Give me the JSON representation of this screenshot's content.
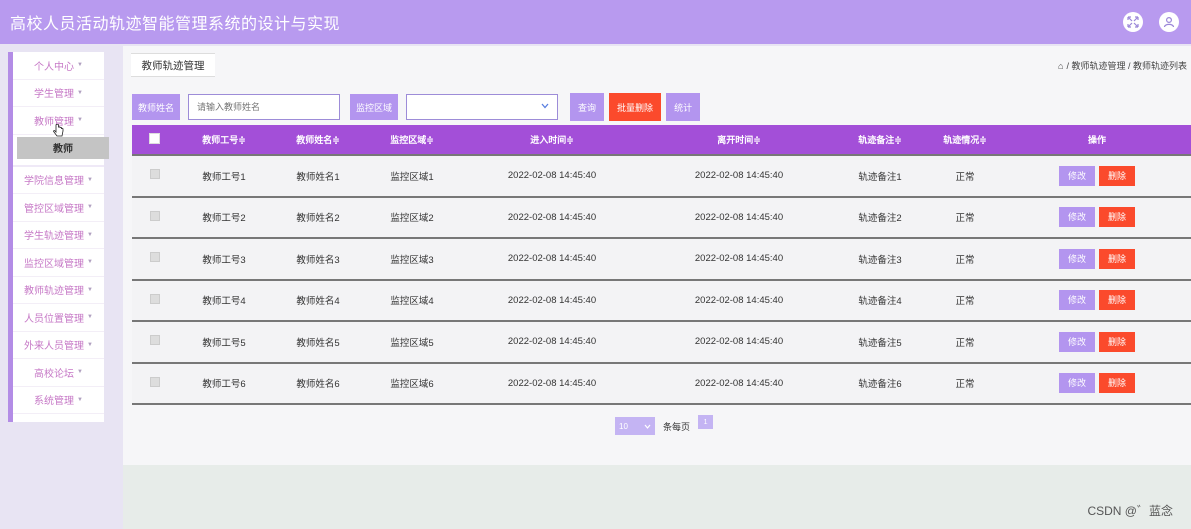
{
  "header": {
    "title": "高校人员活动轨迹智能管理系统的设计与实现",
    "icons": [
      "fullscreen-icon",
      "user-icon"
    ]
  },
  "sidebar": {
    "items_top": [
      {
        "label": "个人中心",
        "caret": "▼"
      },
      {
        "label": "学生管理",
        "caret": "▼"
      },
      {
        "label": "教师管理",
        "caret": "▼"
      }
    ],
    "sub_item": "教师",
    "items_bottom": [
      {
        "label": "学院信息管理",
        "caret": "▼"
      },
      {
        "label": "管控区域管理",
        "caret": "▼"
      },
      {
        "label": "学生轨迹管理",
        "caret": "▼"
      },
      {
        "label": "监控区域管理",
        "caret": "▼"
      },
      {
        "label": "教师轨迹管理",
        "caret": "▼"
      },
      {
        "label": "人员位置管理",
        "caret": "▼"
      },
      {
        "label": "外来人员管理",
        "caret": "▼"
      },
      {
        "label": "高校论坛",
        "caret": "▼"
      },
      {
        "label": "系统管理",
        "caret": "▼"
      }
    ]
  },
  "tab": {
    "label": "教师轨迹管理"
  },
  "breadcrumb": {
    "home_icon": "⌂",
    "text": "/ 教师轨迹管理 / 教师轨迹列表"
  },
  "search": {
    "name_label": "教师姓名",
    "name_placeholder": "请输入教师姓名",
    "area_label": "监控区域",
    "area_value": "",
    "query_btn": "查询",
    "batch_delete_btn": "批量删除",
    "stats_btn": "统计"
  },
  "table": {
    "headers": [
      "教师工号",
      "教师姓名",
      "监控区域",
      "进入时间",
      "离开时间",
      "轨迹备注",
      "轨迹情况",
      "操作"
    ],
    "sort_glyph": "≑",
    "edit_label": "修改",
    "delete_label": "删除",
    "rows": [
      {
        "id": "教师工号1",
        "name": "教师姓名1",
        "area": "监控区域1",
        "enter": "2022-02-08 14:45:40",
        "leave": "2022-02-08 14:45:40",
        "note": "轨迹备注1",
        "status": "正常"
      },
      {
        "id": "教师工号2",
        "name": "教师姓名2",
        "area": "监控区域2",
        "enter": "2022-02-08 14:45:40",
        "leave": "2022-02-08 14:45:40",
        "note": "轨迹备注2",
        "status": "正常"
      },
      {
        "id": "教师工号3",
        "name": "教师姓名3",
        "area": "监控区域3",
        "enter": "2022-02-08 14:45:40",
        "leave": "2022-02-08 14:45:40",
        "note": "轨迹备注3",
        "status": "正常"
      },
      {
        "id": "教师工号4",
        "name": "教师姓名4",
        "area": "监控区域4",
        "enter": "2022-02-08 14:45:40",
        "leave": "2022-02-08 14:45:40",
        "note": "轨迹备注4",
        "status": "正常"
      },
      {
        "id": "教师工号5",
        "name": "教师姓名5",
        "area": "监控区域5",
        "enter": "2022-02-08 14:45:40",
        "leave": "2022-02-08 14:45:40",
        "note": "轨迹备注5",
        "status": "正常"
      },
      {
        "id": "教师工号6",
        "name": "教师姓名6",
        "area": "监控区域6",
        "enter": "2022-02-08 14:45:40",
        "leave": "2022-02-08 14:45:40",
        "note": "轨迹备注6",
        "status": "正常"
      }
    ]
  },
  "pagination": {
    "page_size": "10",
    "per_page_label": "条每页",
    "current_page": "1"
  },
  "watermark": "CSDN @゛蓝念",
  "colors": {
    "header": "#b89aef",
    "accent": "#b395ef",
    "table_header": "#a34fd8",
    "danger": "#fb4a2c",
    "sidebar_text": "#c678c6"
  }
}
